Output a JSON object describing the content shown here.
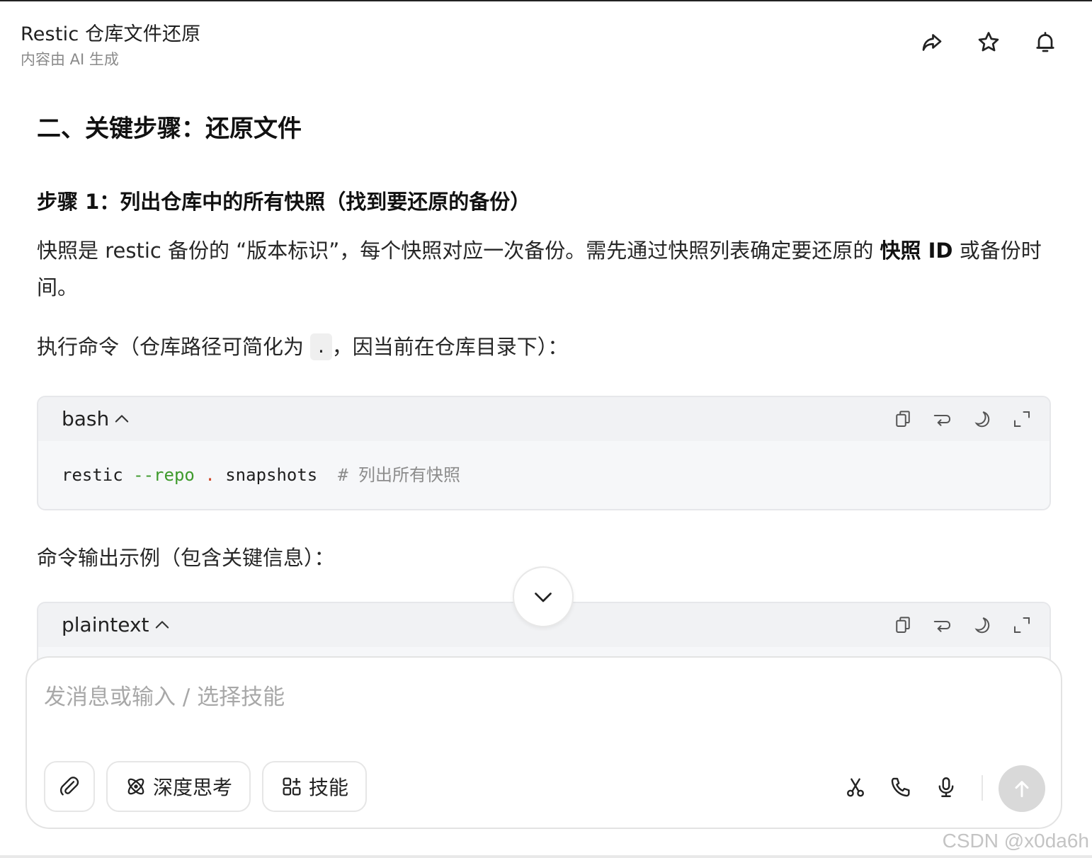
{
  "header": {
    "title": "Restic 仓库文件还原",
    "subtitle": "内容由 AI 生成",
    "icons": [
      "share-icon",
      "star-icon",
      "bell-icon"
    ]
  },
  "article": {
    "section_heading": "二、关键步骤：还原文件",
    "step_heading": "步骤 1：列出仓库中的所有快照（找到要还原的备份）",
    "para1_text": "快照是 restic 备份的 “版本标识”，每个快照对应一次备份。需先通过快照列表确定要还原的 ",
    "para1_bold": "快照 ID",
    "para1_tail": " 或备份时间。",
    "para2_pre": "执行命令（仓库路径可简化为 ",
    "para2_code": ".",
    "para2_post": "，因当前在仓库目录下）：",
    "para3": "命令输出示例（包含关键信息）："
  },
  "code_blocks": [
    {
      "lang": "bash",
      "cmd": "restic ",
      "flag": "--repo",
      "sep": " ",
      "dot": ".",
      "arg": " snapshots  ",
      "comment": "# 列出所有快照"
    },
    {
      "lang": "plaintext"
    }
  ],
  "composer": {
    "placeholder": "发消息或输入 / 选择技能",
    "deep_think_label": "深度思考",
    "skills_label": "技能"
  },
  "watermark": "CSDN @x0da6h"
}
